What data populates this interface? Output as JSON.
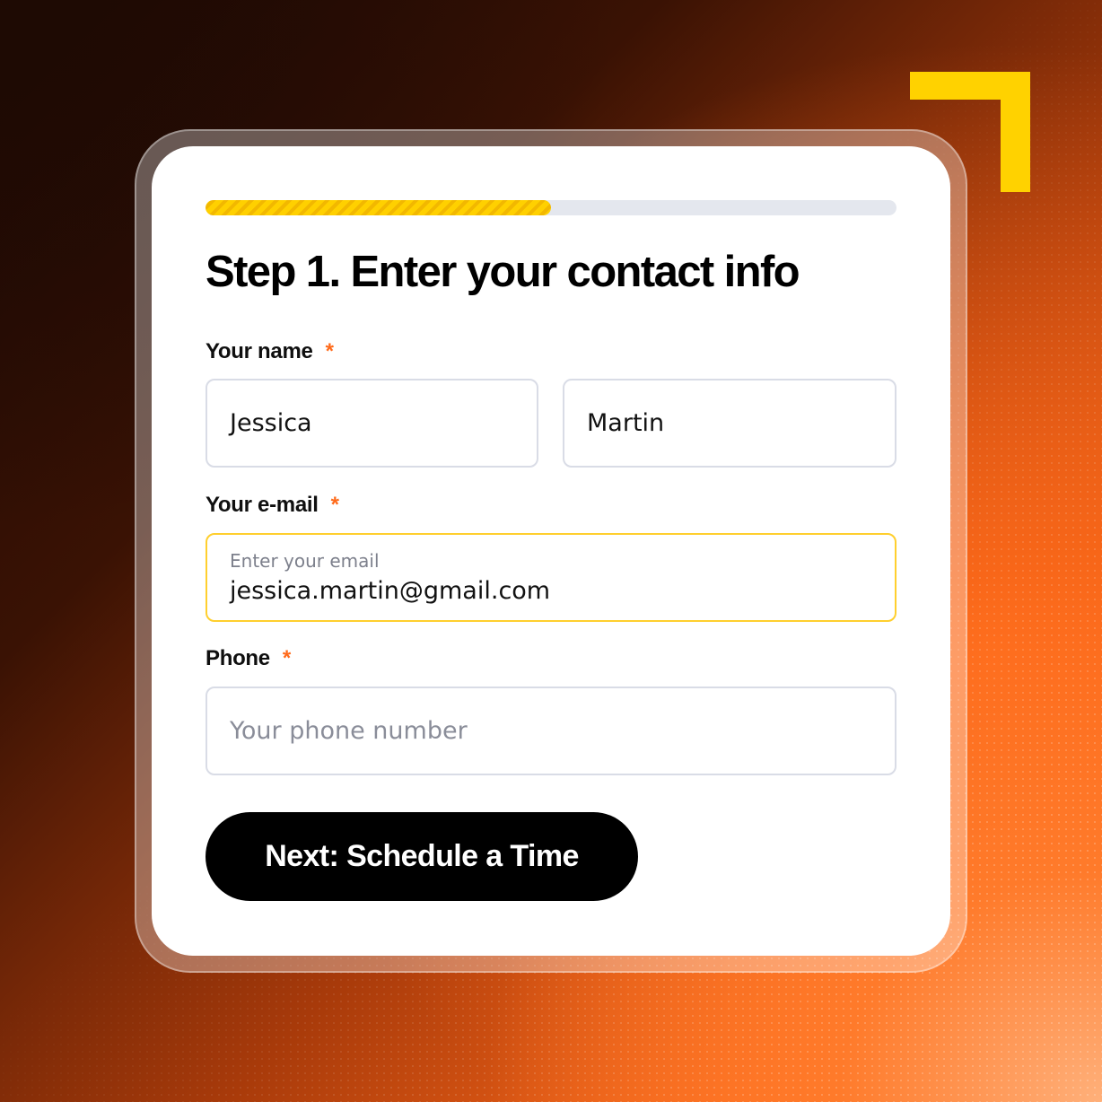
{
  "form": {
    "progress_fraction": 0.5,
    "title": "Step 1. Enter your contact info",
    "name_label": "Your name",
    "first_name_value": "Jessica",
    "last_name_value": "Martin",
    "email_label": "Your e-mail",
    "email_placeholder": "Enter your email",
    "email_value": "jessica.martin@gmail.com",
    "phone_label": "Phone",
    "phone_placeholder": "Your phone number",
    "required_marker": "*",
    "next_button_label": "Next: Schedule a Time"
  },
  "colors": {
    "accent_yellow": "#ffd200",
    "required_orange": "#ff6a1a",
    "button_black": "#000000",
    "focus_border": "#ffcf2e"
  }
}
